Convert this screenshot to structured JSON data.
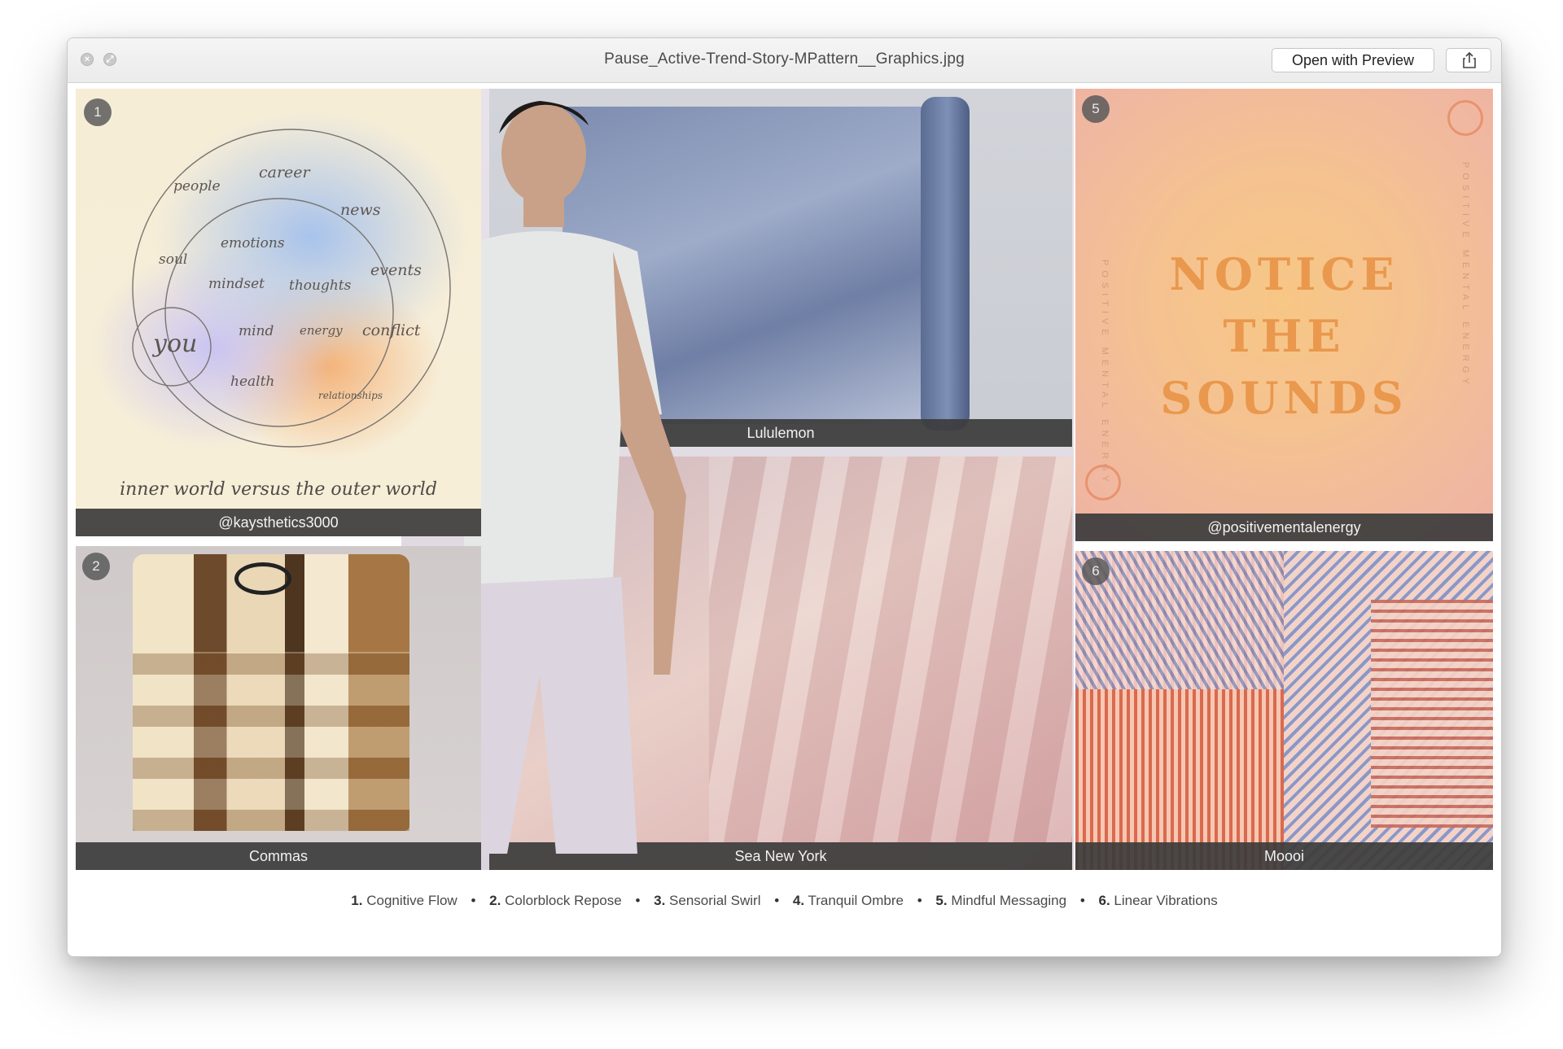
{
  "window": {
    "title": "Pause_Active-Trend-Story-MPattern__Graphics.jpg",
    "open_with_preview_label": "Open with Preview"
  },
  "panels": {
    "p1": {
      "badge": "1",
      "caption": "@kaysthetics3000",
      "words": [
        "people",
        "career",
        "news",
        "soul",
        "emotions",
        "events",
        "mindset",
        "thoughts",
        "you",
        "mind",
        "energy",
        "conflict",
        "health",
        "relationships"
      ],
      "tagline": "inner world versus the outer world"
    },
    "p2": {
      "badge": "2",
      "caption": "Commas"
    },
    "p3": {
      "caption": "Lululemon"
    },
    "p4": {
      "caption": "Sea New York"
    },
    "p5": {
      "badge": "5",
      "caption": "@positivementalenergy",
      "line1": "NOTICE",
      "line2": "THE",
      "line3": "SOUNDS",
      "side_text": "POSITIVE MENTAL ENERGY"
    },
    "p6": {
      "badge": "6",
      "caption": "Moooi"
    }
  },
  "footer": {
    "items": [
      {
        "num": "1.",
        "label": "Cognitive Flow"
      },
      {
        "num": "2.",
        "label": "Colorblock Repose"
      },
      {
        "num": "3.",
        "label": "Sensorial Swirl"
      },
      {
        "num": "4.",
        "label": "Tranquil Ombre"
      },
      {
        "num": "5.",
        "label": "Mindful Messaging"
      },
      {
        "num": "6.",
        "label": "Linear Vibrations"
      }
    ],
    "separator": "•"
  }
}
